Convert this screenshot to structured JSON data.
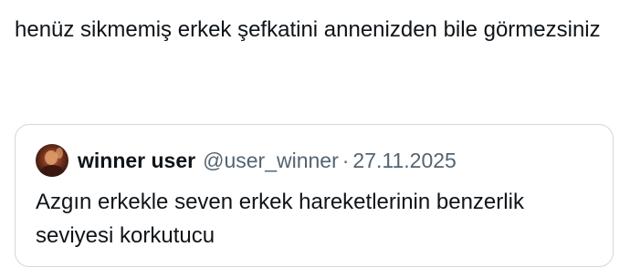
{
  "tweet": {
    "text": "henüz sikmemiş erkek şefkatini annenizden bile görmezsiniz"
  },
  "quoted_tweet": {
    "display_name": "winner user",
    "handle": "@user_winner",
    "separator": "·",
    "date": "27.11.2025",
    "text": "Azgın erkekle seven erkek hareketlerinin benzerlik seviyesi korkutucu",
    "avatar_icon": "user-avatar-photo"
  },
  "colors": {
    "text_primary": "#0f1419",
    "text_secondary": "#536471",
    "border": "#cfd9de",
    "background": "#ffffff"
  }
}
